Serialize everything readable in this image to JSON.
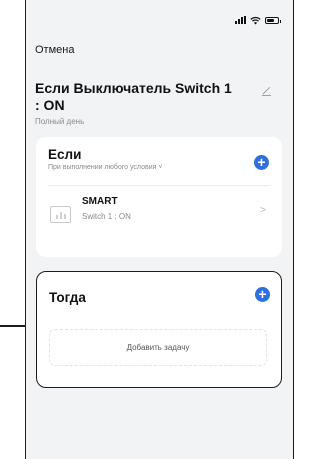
{
  "header": {
    "cancel_label": "Отмена",
    "rule_title": "Если Выключатель Switch 1 : ON",
    "rule_subtitle": "Полный день"
  },
  "if_section": {
    "title": "Если",
    "subtitle": "При выполнении любого условия ˅",
    "conditions": [
      {
        "name": "SMART",
        "state": "Switch 1 : ON",
        "icon": "device-icon"
      }
    ]
  },
  "then_section": {
    "title": "Тогда",
    "add_task_label": "Добавить задачу"
  },
  "icons": {
    "add": "plus-circle-icon",
    "edit": "pencil-icon",
    "chevron": "chevron-right-icon"
  },
  "colors": {
    "accent": "#2f6fde",
    "background": "#f2f3f5",
    "card": "#ffffff"
  }
}
